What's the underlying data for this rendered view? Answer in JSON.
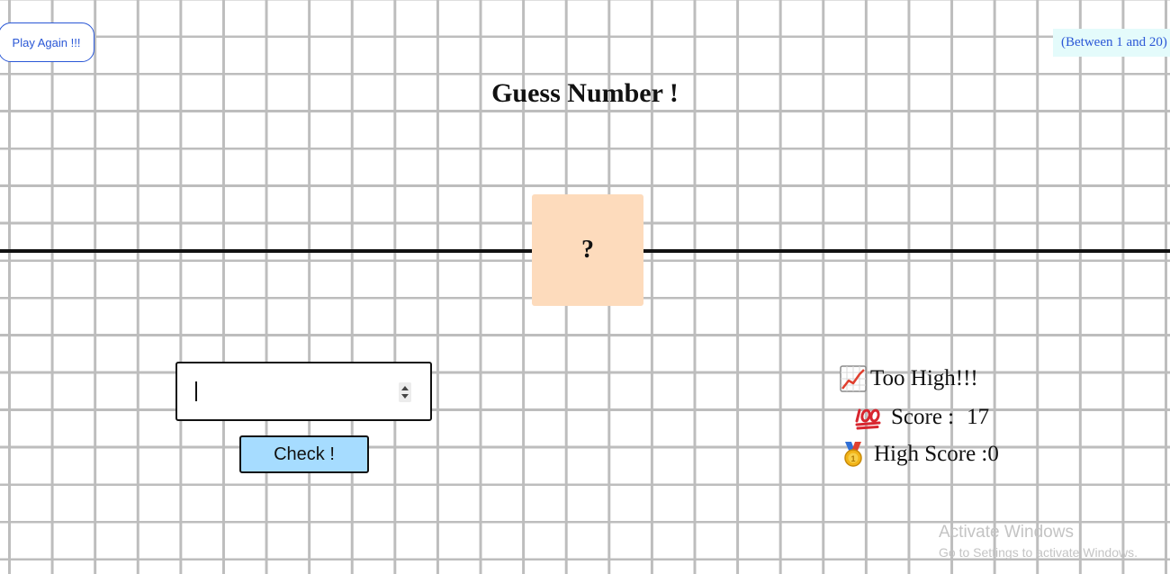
{
  "header": {
    "play_again_label": "Play Again !!!",
    "range_hint": "(Between 1 and 20)",
    "title": "Guess Number !"
  },
  "secret": {
    "display": "?"
  },
  "guess_form": {
    "input_value": "",
    "input_type": "number",
    "check_label": "Check !"
  },
  "status": {
    "message_icon": "chart-increasing-icon",
    "message": "Too High!!!",
    "score_icon": "hundred-points-icon",
    "score_label": "Score :",
    "score_value": "17",
    "high_score_icon": "medal-icon",
    "high_score_label": "High Score :",
    "high_score_value": "0"
  },
  "watermark": {
    "title": "Activate Windows",
    "subtitle": "Go to Settings to activate Windows."
  },
  "colors": {
    "accent_blue": "#2a57d6",
    "secret_box": "#fddbbc",
    "check_button": "#a6dcff",
    "hint_background": "#e4fbfb",
    "grid_line": "#bdbdbd"
  }
}
